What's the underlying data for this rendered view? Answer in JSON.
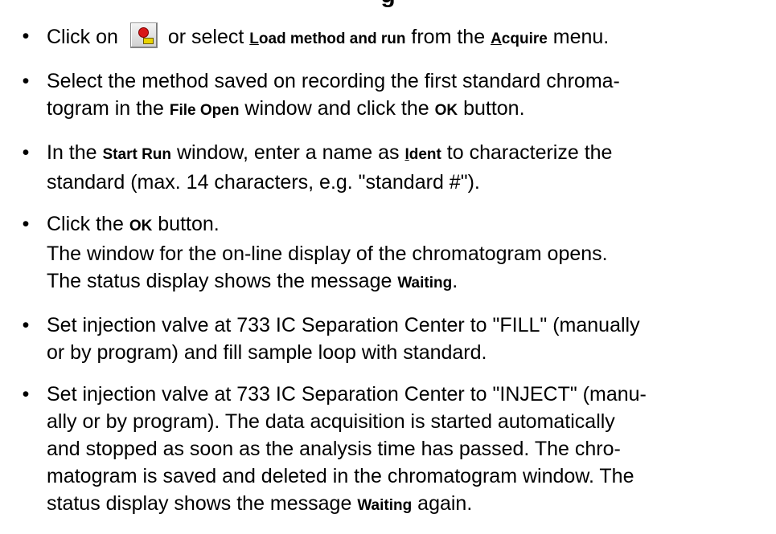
{
  "title": "g",
  "items": [
    {
      "parts": [
        {
          "t": "Click on "
        },
        {
          "icon": "load-run-icon"
        },
        {
          "t": " or select "
        },
        {
          "t": "L",
          "b": true,
          "u": true
        },
        {
          "t": "oad method and run",
          "b": true
        },
        {
          "t": " from the "
        },
        {
          "t": "A",
          "b": true,
          "u": true
        },
        {
          "t": "cquire",
          "b": true
        },
        {
          "t": " menu."
        }
      ]
    },
    {
      "parts": [
        {
          "t": "Select the method saved on recording the first standard chroma-"
        },
        {
          "br": true
        },
        {
          "t": "togram in the "
        },
        {
          "t": "File Open",
          "b": true
        },
        {
          "t": " window and click the "
        },
        {
          "t": "OK",
          "b": true
        },
        {
          "t": " button."
        }
      ]
    },
    {
      "parts": [
        {
          "t": "In the "
        },
        {
          "t": "Start Run",
          "b": true
        },
        {
          "t": " window, enter a name as "
        },
        {
          "t": "I",
          "b": true,
          "u": true
        },
        {
          "t": "dent",
          "b": true
        },
        {
          "t": " to characterize the"
        },
        {
          "br": true
        },
        {
          "t": "standard (max. 14 characters, e.g. \"standard #\")."
        }
      ]
    },
    {
      "parts": [
        {
          "t": "Click the "
        },
        {
          "t": "OK",
          "b": true
        },
        {
          "t": " button."
        },
        {
          "br": true
        },
        {
          "t": "The window for the on-line display of the chromatogram opens."
        },
        {
          "br": true
        },
        {
          "t": "The status display shows the message "
        },
        {
          "t": "Waiting",
          "b": true
        },
        {
          "t": "."
        }
      ]
    },
    {
      "parts": [
        {
          "t": "Set injection valve at 733 IC Separation Center to \"FILL\" (manually"
        },
        {
          "br": true
        },
        {
          "t": "or by program) and fill sample loop with standard."
        }
      ]
    },
    {
      "parts": [
        {
          "t": "Set injection valve at 733 IC Separation Center to \"INJECT\" (manu-"
        },
        {
          "br": true
        },
        {
          "t": "ally or by program). The data acquisition is started automatically"
        },
        {
          "br": true
        },
        {
          "t": "and stopped as soon as the analysis time has passed. The chro-"
        },
        {
          "br": true
        },
        {
          "t": "matogram is saved and deleted in the chromatogram window. The"
        },
        {
          "br": true
        },
        {
          "t": "status display shows the message "
        },
        {
          "t": "Waiting",
          "b": true
        },
        {
          "t": " again."
        }
      ]
    }
  ]
}
